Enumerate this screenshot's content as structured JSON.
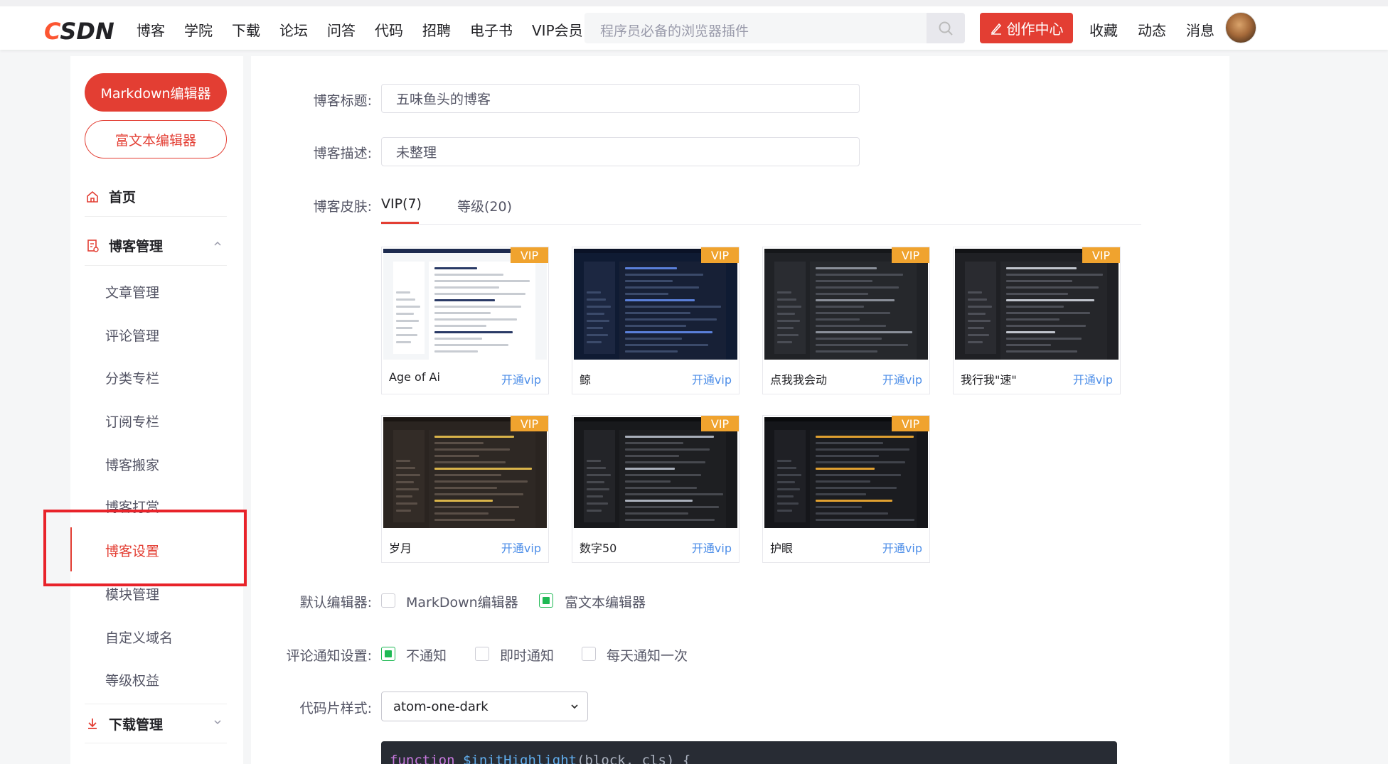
{
  "header": {
    "logo_main": "CSDN",
    "nav": [
      "博客",
      "学院",
      "下载",
      "论坛",
      "问答",
      "代码",
      "招聘",
      "电子书",
      "VIP会员"
    ],
    "search_placeholder": "程序员必备的浏览器插件",
    "create_label": "创作中心",
    "links": [
      "收藏",
      "动态",
      "消息"
    ]
  },
  "sidebar": {
    "markdown_btn": "Markdown编辑器",
    "richtext_btn": "富文本编辑器",
    "home": "首页",
    "blog_manage": "博客管理",
    "items": [
      "文章管理",
      "评论管理",
      "分类专栏",
      "订阅专栏",
      "博客搬家",
      "博客打赏",
      "博客设置",
      "模块管理",
      "自定义域名",
      "等级权益"
    ],
    "download_manage": "下载管理"
  },
  "form": {
    "title_label": "博客标题:",
    "title_value": "五味鱼头的博客",
    "desc_label": "博客描述:",
    "desc_value": "未整理",
    "skin_label": "博客皮肤:",
    "tabs": [
      "VIP(7)",
      "等级(20)"
    ],
    "editor_label": "默认编辑器:",
    "editor_options": [
      "MarkDown编辑器",
      "富文本编辑器"
    ],
    "notify_label": "评论通知设置:",
    "notify_options": [
      "不通知",
      "即时通知",
      "每天通知一次"
    ],
    "code_label": "代码片样式:",
    "code_style": "atom-one-dark",
    "code_preview": "function $initHighlight(block, cls) {"
  },
  "skins": [
    {
      "name": "Age of Ai",
      "badge": "VIP",
      "action": "开通vip"
    },
    {
      "name": "鲸",
      "badge": "VIP",
      "action": "开通vip"
    },
    {
      "name": "点我我会动",
      "badge": "VIP",
      "action": "开通vip"
    },
    {
      "name": "我行我\"速\"",
      "badge": "VIP",
      "action": "开通vip"
    },
    {
      "name": "岁月",
      "badge": "VIP",
      "action": "开通vip"
    },
    {
      "name": "数字50",
      "badge": "VIP",
      "action": "开通vip"
    },
    {
      "name": "护眼",
      "badge": "VIP",
      "action": "开通vip"
    }
  ],
  "colors": {
    "accent": "#e33e33",
    "vip": "#f0a32e",
    "link": "#4d8ee8",
    "check": "#1eb954"
  }
}
